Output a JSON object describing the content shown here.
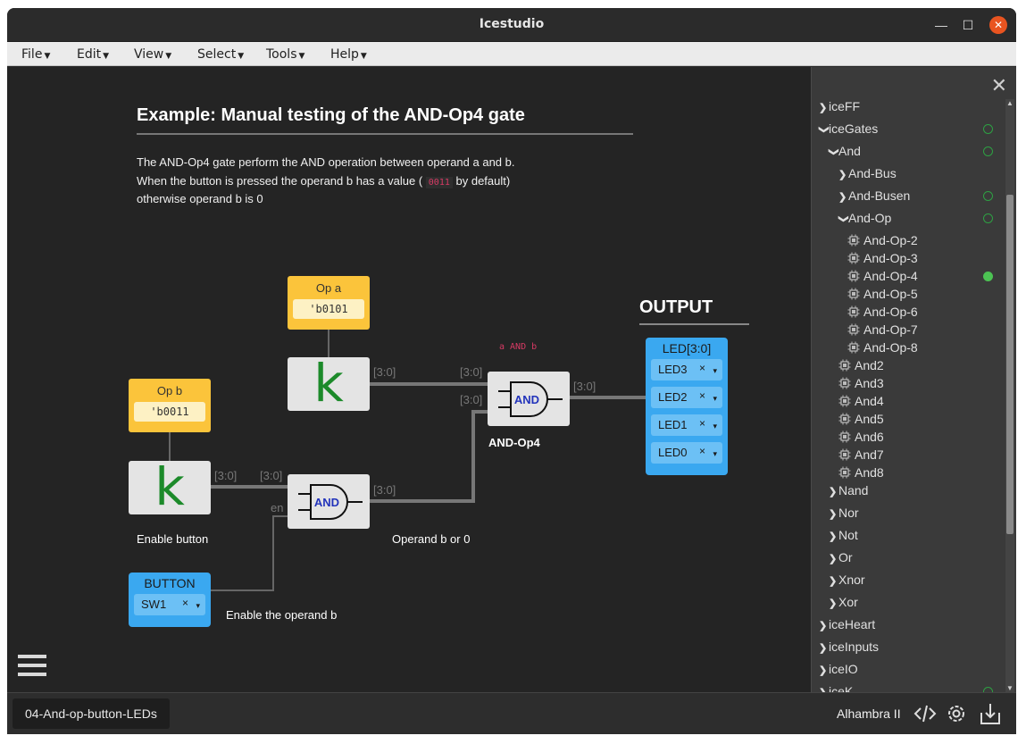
{
  "window": {
    "title": "Icestudio"
  },
  "menu": [
    "File",
    "Edit",
    "View",
    "Select",
    "Tools",
    "Help"
  ],
  "doc": {
    "title": "Example: Manual testing of the AND-Op4 gate",
    "line1": "The AND-Op4 gate perform the AND operation between operand a and b.",
    "line2_pre": "When the button is pressed the operand b has a value (",
    "line2_code": "0011",
    "line2_post": "by default)",
    "line3": "otherwise operand b is 0"
  },
  "blocks": {
    "op_a": {
      "label": "Op a",
      "value": "'b0101"
    },
    "op_b": {
      "label": "Op b",
      "value": "'b0011"
    },
    "k_glyph": "k",
    "and_label": "AND",
    "gate_caption": "AND-Op4",
    "gate_annotation": "a AND b",
    "enable_button_caption": "Enable button",
    "operand_caption": "Operand b or 0",
    "enable_operand_caption": "Enable the operand b",
    "port_labels": {
      "bus": "[3:0]",
      "en": "en"
    },
    "button": {
      "header": "BUTTON",
      "pin": "SW1"
    },
    "output": {
      "title": "OUTPUT",
      "header": "LED[3:0]",
      "pins": [
        "LED3",
        "LED2",
        "LED1",
        "LED0"
      ]
    },
    "remove_glyph": "×",
    "dropdown_glyph": "▾"
  },
  "sidebar": {
    "close": "✕",
    "items": [
      {
        "label": "iceFF",
        "arrow": "›",
        "dot": ""
      },
      {
        "label": "iceGates",
        "arrow": "⌄",
        "dot": "open"
      },
      {
        "label": "And",
        "arrow": "⌄",
        "dot": "open"
      },
      {
        "label": "And-Bus",
        "arrow": "›",
        "dot": ""
      },
      {
        "label": "And-Busen",
        "arrow": "›",
        "dot": "open"
      },
      {
        "label": "And-Op",
        "arrow": "⌄",
        "dot": "open"
      },
      {
        "label": "And-Op-2",
        "arrow": "",
        "dot": ""
      },
      {
        "label": "And-Op-3",
        "arrow": "",
        "dot": ""
      },
      {
        "label": "And-Op-4",
        "arrow": "",
        "dot": "filled"
      },
      {
        "label": "And-Op-5",
        "arrow": "",
        "dot": ""
      },
      {
        "label": "And-Op-6",
        "arrow": "",
        "dot": ""
      },
      {
        "label": "And-Op-7",
        "arrow": "",
        "dot": ""
      },
      {
        "label": "And-Op-8",
        "arrow": "",
        "dot": ""
      },
      {
        "label": "And2",
        "arrow": "",
        "dot": ""
      },
      {
        "label": "And3",
        "arrow": "",
        "dot": ""
      },
      {
        "label": "And4",
        "arrow": "",
        "dot": ""
      },
      {
        "label": "And5",
        "arrow": "",
        "dot": ""
      },
      {
        "label": "And6",
        "arrow": "",
        "dot": ""
      },
      {
        "label": "And7",
        "arrow": "",
        "dot": ""
      },
      {
        "label": "And8",
        "arrow": "",
        "dot": ""
      },
      {
        "label": "Nand",
        "arrow": "›",
        "dot": ""
      },
      {
        "label": "Nor",
        "arrow": "›",
        "dot": ""
      },
      {
        "label": "Not",
        "arrow": "›",
        "dot": ""
      },
      {
        "label": "Or",
        "arrow": "›",
        "dot": ""
      },
      {
        "label": "Xnor",
        "arrow": "›",
        "dot": ""
      },
      {
        "label": "Xor",
        "arrow": "›",
        "dot": ""
      },
      {
        "label": "iceHeart",
        "arrow": "›",
        "dot": ""
      },
      {
        "label": "iceInputs",
        "arrow": "›",
        "dot": ""
      },
      {
        "label": "iceIO",
        "arrow": "›",
        "dot": ""
      },
      {
        "label": "iceK",
        "arrow": "›",
        "dot": "open"
      }
    ]
  },
  "footer": {
    "tab": "04-And-op-button-LEDs",
    "board": "Alhambra II",
    "icons": [
      "code-icon",
      "settings-icon",
      "download-icon"
    ]
  },
  "colors": {
    "accent": "#e95420",
    "yellow": "#fbc43b",
    "blue": "#3aa8f0",
    "green": "#4cc253",
    "k_green": "#1c8a2a",
    "code_red": "#d63a64"
  }
}
